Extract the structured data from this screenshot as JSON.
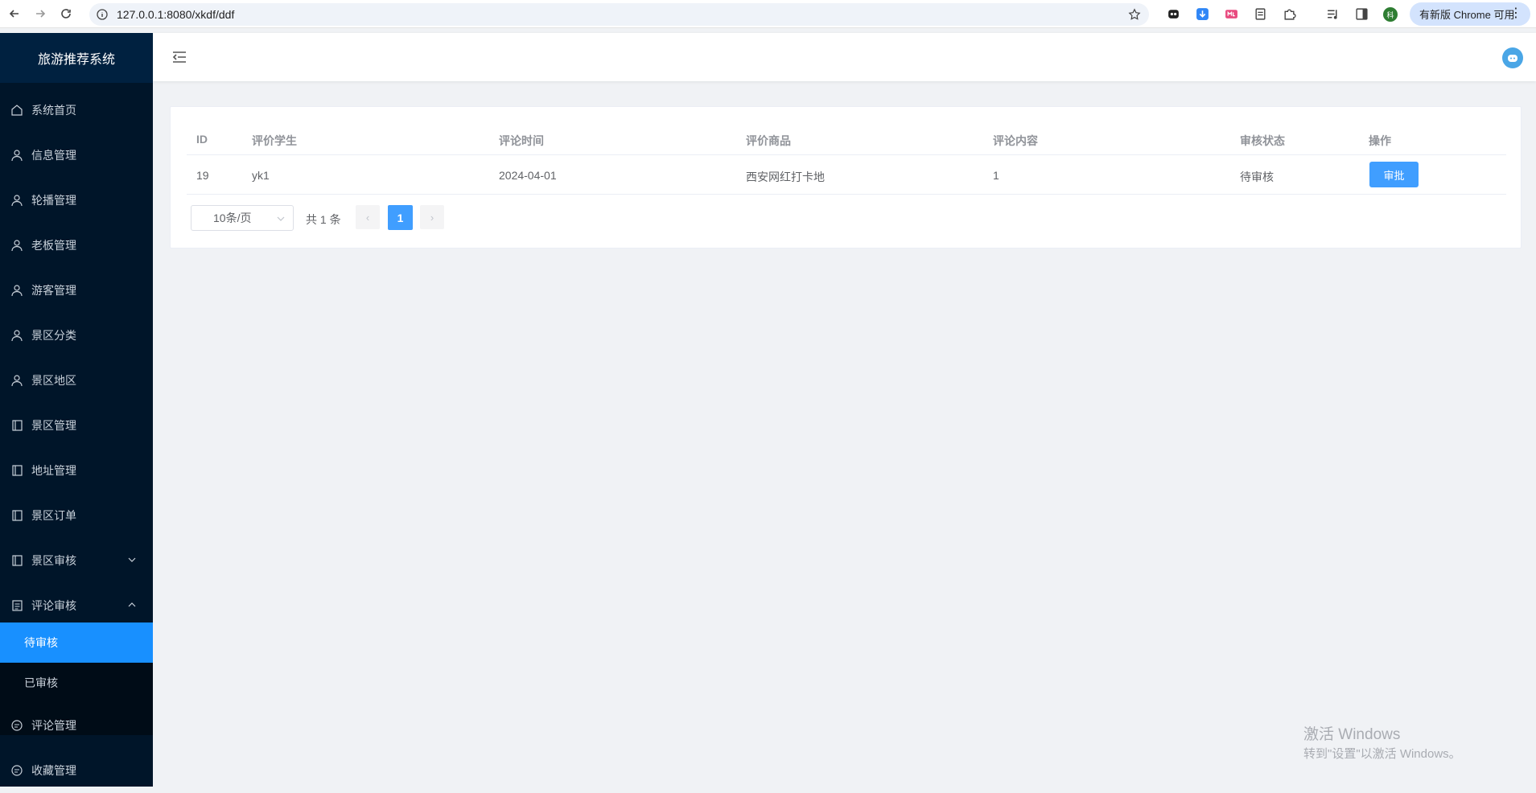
{
  "browser": {
    "url": "127.0.0.1:8080/xkdf/ddf",
    "update_label": "有新版 Chrome 可用",
    "profile_initial": "科"
  },
  "sidebar": {
    "title": "旅游推荐系统",
    "items": [
      {
        "label": "系统首页",
        "icon": "home-icon"
      },
      {
        "label": "信息管理",
        "icon": "user-icon"
      },
      {
        "label": "轮播管理",
        "icon": "user-icon"
      },
      {
        "label": "老板管理",
        "icon": "user-icon"
      },
      {
        "label": "游客管理",
        "icon": "user-icon"
      },
      {
        "label": "景区分类",
        "icon": "user-icon"
      },
      {
        "label": "景区地区",
        "icon": "user-icon"
      },
      {
        "label": "景区管理",
        "icon": "notebook-icon"
      },
      {
        "label": "地址管理",
        "icon": "notebook-icon"
      },
      {
        "label": "景区订单",
        "icon": "notebook-icon"
      },
      {
        "label": "景区审核",
        "icon": "notebook-icon"
      },
      {
        "label": "评论审核",
        "icon": "document-icon"
      },
      {
        "label": "评论管理",
        "icon": "chat-icon"
      },
      {
        "label": "收藏管理",
        "icon": "chat-icon"
      }
    ],
    "submenu": [
      {
        "label": "待审核",
        "active": true
      },
      {
        "label": "已审核",
        "active": false
      }
    ]
  },
  "table": {
    "headers": [
      "ID",
      "评价学生",
      "评论时间",
      "评价商品",
      "评论内容",
      "审核状态",
      "操作"
    ],
    "rows": [
      {
        "id": "19",
        "student": "yk1",
        "time": "2024-04-01",
        "product": "西安网红打卡地",
        "content": "1",
        "status": "待审核",
        "action": "审批"
      }
    ]
  },
  "pagination": {
    "page_size": "10条/页",
    "total": "共 1 条",
    "current_page": "1"
  },
  "watermark": {
    "line1": "激活 Windows",
    "line2": "转到\"设置\"以激活 Windows。"
  },
  "colors": {
    "sidebar_bg": "#001529",
    "accent": "#1890ff",
    "button": "#409eff"
  }
}
